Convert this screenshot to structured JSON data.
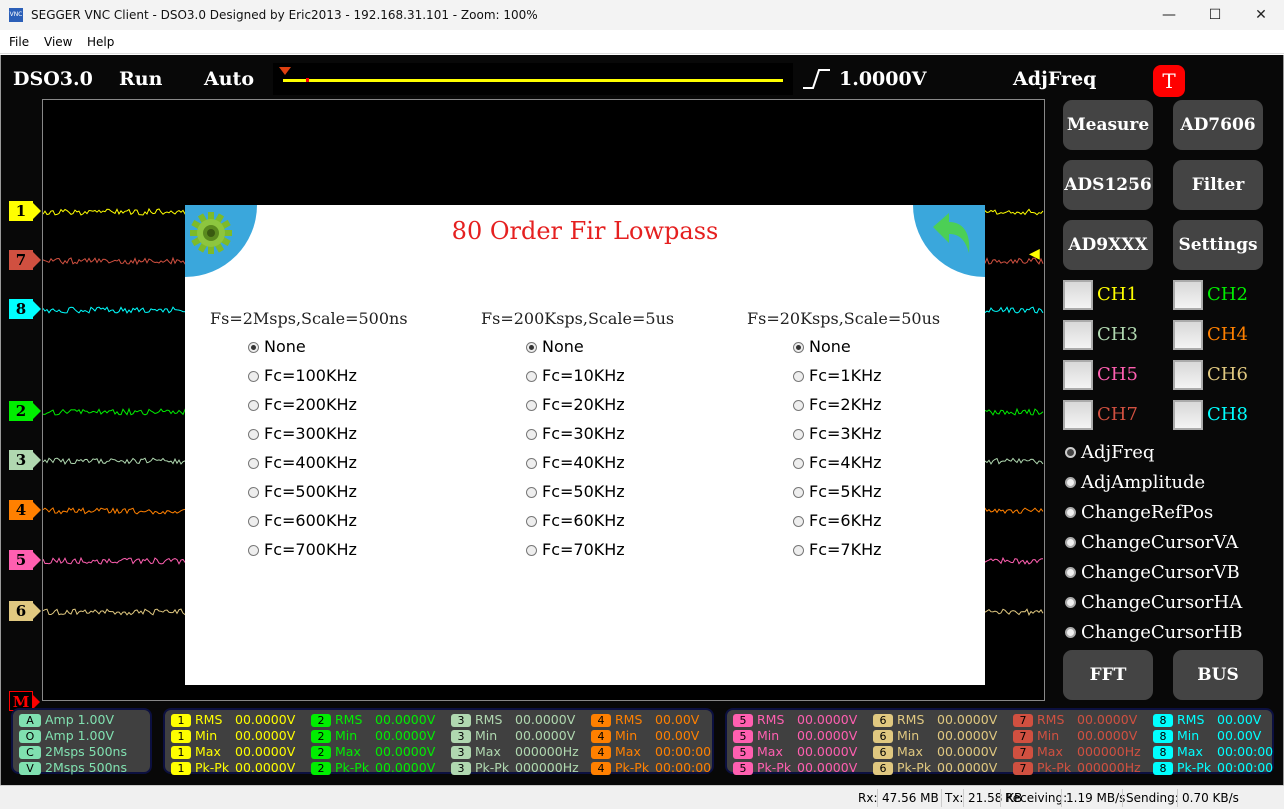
{
  "window": {
    "title": "SEGGER VNC Client - DSO3.0 Designed by Eric2013 - 192.168.31.101 - Zoom: 100%",
    "logo": "VNC",
    "minimize": "—",
    "maximize": "☐",
    "close": "✕"
  },
  "menu": [
    "File",
    "View",
    "Help"
  ],
  "header": {
    "app": "DSO3.0",
    "run": "Run",
    "mode": "Auto",
    "trigger_level": "1.0000V",
    "adjust": "AdjFreq",
    "trigger_badge": "T"
  },
  "colors": {
    "ch1": "#ffff00",
    "ch2": "#00ee00",
    "ch3": "#b0d8b0",
    "ch4": "#ff8000",
    "ch5": "#ff5fb0",
    "ch6": "#e0c880",
    "ch7": "#d05040",
    "ch8": "#00ffff",
    "math": "#ff0000",
    "accent": "#3aa7dc"
  },
  "markers": [
    {
      "label": "1",
      "ch": "ch1"
    },
    {
      "label": "7",
      "ch": "ch7"
    },
    {
      "label": "8",
      "ch": "ch8"
    },
    {
      "label": "2",
      "ch": "ch2"
    },
    {
      "label": "3",
      "ch": "ch3"
    },
    {
      "label": "4",
      "ch": "ch4"
    },
    {
      "label": "5",
      "ch": "ch5"
    },
    {
      "label": "6",
      "ch": "ch6"
    },
    {
      "label": "M",
      "ch": "math"
    }
  ],
  "dialog": {
    "title": "80 Order Fir Lowpass",
    "settings_icon": "gear-icon",
    "back_icon": "back-arrow-icon",
    "columns": [
      {
        "header": "Fs=2Msps,Scale=500ns",
        "options": [
          "None",
          "Fc=100KHz",
          "Fc=200KHz",
          "Fc=300KHz",
          "Fc=400KHz",
          "Fc=500KHz",
          "Fc=600KHz",
          "Fc=700KHz"
        ],
        "selected": 0
      },
      {
        "header": "Fs=200Ksps,Scale=5us",
        "options": [
          "None",
          "Fc=10KHz",
          "Fc=20KHz",
          "Fc=30KHz",
          "Fc=40KHz",
          "Fc=50KHz",
          "Fc=60KHz",
          "Fc=70KHz"
        ],
        "selected": 0
      },
      {
        "header": "Fs=20Ksps,Scale=50us",
        "options": [
          "None",
          "Fc=1KHz",
          "Fc=2KHz",
          "Fc=3KHz",
          "Fc=4KHz",
          "Fc=5KHz",
          "Fc=6KHz",
          "Fc=7KHz"
        ],
        "selected": 0
      }
    ]
  },
  "buttons": [
    "Measure",
    "AD7606",
    "ADS1256",
    "Filter",
    "AD9XXX",
    "Settings"
  ],
  "channels": [
    {
      "label": "CH1",
      "ch": "ch1"
    },
    {
      "label": "CH2",
      "ch": "ch2"
    },
    {
      "label": "CH3",
      "ch": "ch3"
    },
    {
      "label": "CH4",
      "ch": "ch4"
    },
    {
      "label": "CH5",
      "ch": "ch5"
    },
    {
      "label": "CH6",
      "ch": "ch6"
    },
    {
      "label": "CH7",
      "ch": "ch7"
    },
    {
      "label": "CH8",
      "ch": "ch8"
    }
  ],
  "modes": {
    "items": [
      "AdjFreq",
      "AdjAmplitude",
      "ChangeRefPos",
      "ChangeCursorVA",
      "ChangeCursorVB",
      "ChangeCursorHA",
      "ChangeCursorHB"
    ],
    "selected": 0
  },
  "bottom_buttons": [
    "FFT",
    "BUS"
  ],
  "info_panel": [
    {
      "badge": "A",
      "text": "Amp  1.00V"
    },
    {
      "badge": "O",
      "text": "Amp  1.00V"
    },
    {
      "badge": "C",
      "text": "2Msps  500ns"
    },
    {
      "badge": "V",
      "text": "2Msps  500ns"
    }
  ],
  "measurements": [
    {
      "ch": "ch1",
      "num": "1",
      "rows": [
        [
          "RMS",
          "00.0000V"
        ],
        [
          "Min",
          "00.0000V"
        ],
        [
          "Max",
          "00.0000V"
        ],
        [
          "Pk-Pk",
          "00.0000V"
        ]
      ]
    },
    {
      "ch": "ch2",
      "num": "2",
      "rows": [
        [
          "RMS",
          "00.0000V"
        ],
        [
          "Min",
          "00.0000V"
        ],
        [
          "Max",
          "00.0000V"
        ],
        [
          "Pk-Pk",
          "00.0000V"
        ]
      ]
    },
    {
      "ch": "ch3",
      "num": "3",
      "rows": [
        [
          "RMS",
          "00.0000V"
        ],
        [
          "Min",
          "00.0000V"
        ],
        [
          "Max",
          "000000Hz"
        ],
        [
          "Pk-Pk",
          "000000Hz"
        ]
      ]
    },
    {
      "ch": "ch4",
      "num": "4",
      "rows": [
        [
          "RMS",
          "00.00V"
        ],
        [
          "Min",
          "00.00V"
        ],
        [
          "Max",
          "00:00:00"
        ],
        [
          "Pk-Pk",
          "00:00:00"
        ]
      ]
    },
    {
      "ch": "ch5",
      "num": "5",
      "rows": [
        [
          "RMS",
          "00.0000V"
        ],
        [
          "Min",
          "00.0000V"
        ],
        [
          "Max",
          "00.0000V"
        ],
        [
          "Pk-Pk",
          "00.0000V"
        ]
      ]
    },
    {
      "ch": "ch6",
      "num": "6",
      "rows": [
        [
          "RMS",
          "00.0000V"
        ],
        [
          "Min",
          "00.0000V"
        ],
        [
          "Max",
          "00.0000V"
        ],
        [
          "Pk-Pk",
          "00.0000V"
        ]
      ]
    },
    {
      "ch": "ch7",
      "num": "7",
      "rows": [
        [
          "RMS",
          "00.0000V"
        ],
        [
          "Min",
          "00.0000V"
        ],
        [
          "Max",
          "000000Hz"
        ],
        [
          "Pk-Pk",
          "000000Hz"
        ]
      ]
    },
    {
      "ch": "ch8",
      "num": "8",
      "rows": [
        [
          "RMS",
          "00.00V"
        ],
        [
          "Min",
          "00.00V"
        ],
        [
          "Max",
          "00:00:00"
        ],
        [
          "Pk-Pk",
          "00:00:00"
        ]
      ]
    }
  ],
  "status": {
    "rx_label": "Rx:",
    "rx": "47.56 MB",
    "tx_label": "Tx:",
    "tx": "21.58 KB",
    "recv_label": "Receiving:",
    "recv": "1.19 MB/s",
    "send_label": "Sending:",
    "send": "0.70 KB/s"
  }
}
